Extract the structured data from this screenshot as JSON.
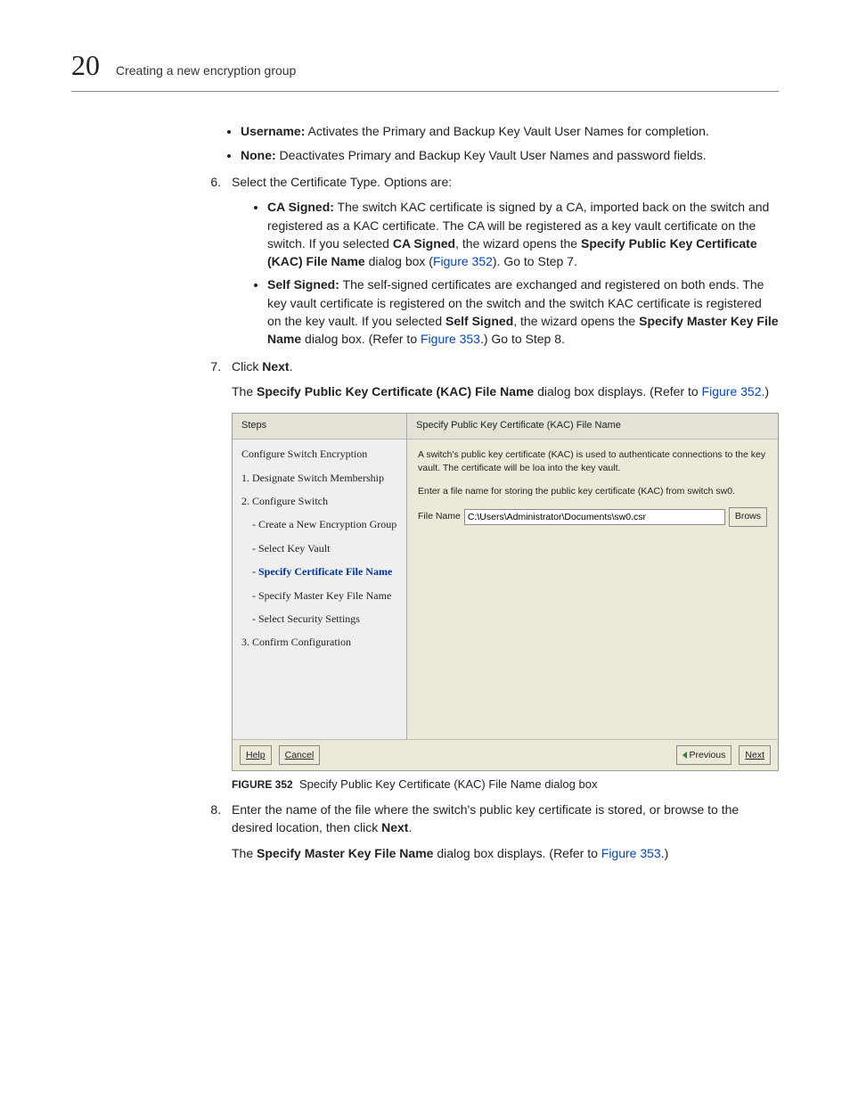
{
  "header": {
    "chapter_number": "20",
    "chapter_title": "Creating a new encryption group"
  },
  "intro_bullets": [
    {
      "label": "Username:",
      "text": " Activates the Primary and Backup Key Vault User Names for completion."
    },
    {
      "label": "None:",
      "text": " Deactivates Primary and Backup Key Vault User Names and password fields."
    }
  ],
  "step6": {
    "intro": "Select the Certificate Type. Options are:",
    "bullets": {
      "ca": {
        "label": "CA Signed:",
        "p1": " The switch KAC certificate is signed by a CA, imported back on the switch and registered as a KAC certificate. The CA will be registered as a key vault certificate on the switch. If you selected ",
        "b1": "CA Signed",
        "p2": ", the wizard opens the ",
        "b2": "Specify Public Key Certificate (KAC) File Name",
        "p3": " dialog box (",
        "link": "Figure 352",
        "p4": "). Go to Step 7."
      },
      "self": {
        "label": "Self Signed:",
        "p1": " The self-signed certificates are exchanged and registered on both ends. The key vault certificate is registered on the switch and the switch KAC certificate is registered on the key vault. If you selected ",
        "b1": "Self Signed",
        "p2": ", the wizard opens the ",
        "b2": "Specify Master Key File Name",
        "p3": " dialog box. (Refer to ",
        "link": "Figure 353",
        "p4": ".) Go to Step 8."
      }
    }
  },
  "step7": {
    "intro_pre": "Click ",
    "intro_b": "Next",
    "intro_post": ".",
    "body_pre": "The ",
    "body_b": "Specify Public Key Certificate (KAC) File Name",
    "body_mid": " dialog box displays. (Refer to ",
    "body_link": "Figure 352",
    "body_post": ".)"
  },
  "dialog": {
    "steps_header": "Steps",
    "steps_title": "Configure Switch Encryption",
    "steps": {
      "s1": "1. Designate Switch Membership",
      "s2": "2. Configure Switch",
      "s2a": "- Create a New Encryption Group",
      "s2b": "- Select Key Vault",
      "s2c": "- Specify Certificate File Name",
      "s2d": "- Specify Master Key File Name",
      "s2e": "- Select Security Settings",
      "s3": "3. Confirm Configuration"
    },
    "right_header": "Specify Public Key Certificate (KAC) File Name",
    "desc1": "A switch's public key certificate (KAC) is used to authenticate connections to the key vault. The certificate will be loa into the key vault.",
    "desc2": "Enter a file name for storing the public key certificate (KAC) from switch sw0.",
    "file_label": "File Name",
    "file_value": "C:\\Users\\Administrator\\Documents\\sw0.csr",
    "browse": "Brows",
    "help": "Help",
    "cancel": "Cancel",
    "prev": "Previous",
    "next": "Next"
  },
  "figure_caption": {
    "label": "FIGURE 352",
    "text": "Specify Public Key Certificate (KAC) File Name dialog box"
  },
  "step8": {
    "p1_a": "Enter the name of the file where the switch's public key certificate is stored, or browse to the desired location, then click ",
    "p1_b": "Next",
    "p1_c": ".",
    "p2_a": "The ",
    "p2_b": "Specify Master Key File Name",
    "p2_c": " dialog box displays. (Refer to ",
    "p2_link": "Figure 353",
    "p2_d": ".)"
  }
}
